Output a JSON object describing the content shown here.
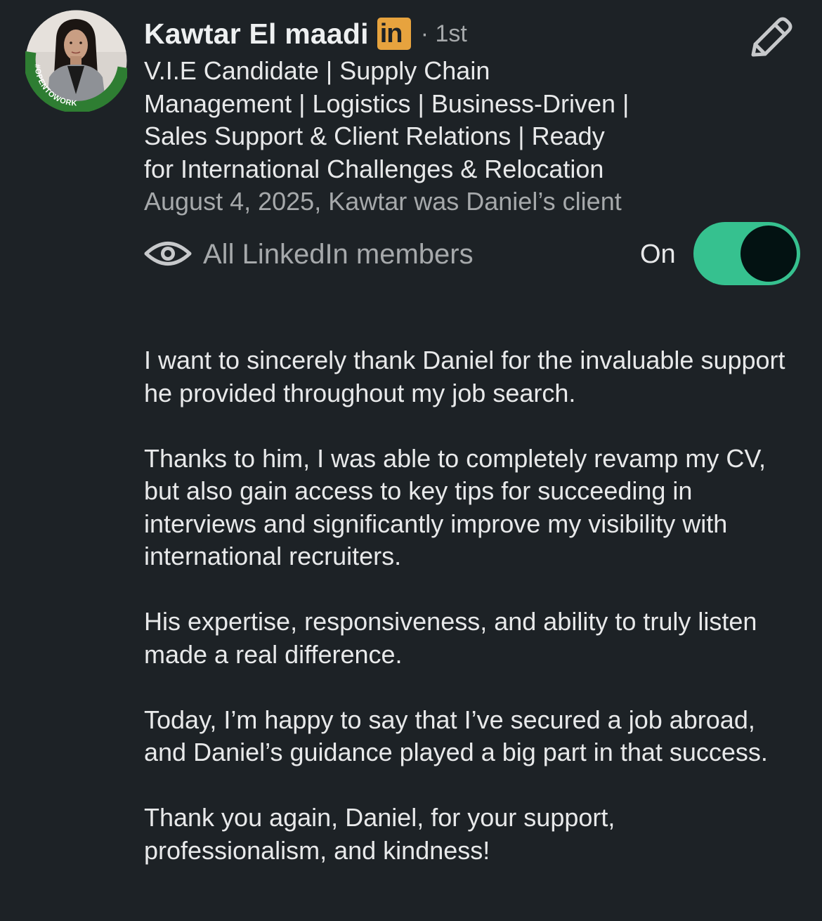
{
  "author": {
    "name": "Kawtar El maadi",
    "badge_text": "in",
    "degree": "· 1st",
    "avatar_frame_text": "#OPENTOWORK",
    "headline_lines": [
      "V.I.E Candidate | Supply Chain",
      "Management | Logistics | Business-Driven |",
      "Sales Support & Client Relations | Ready",
      "for International Challenges & Relocation"
    ],
    "meta": "August 4, 2025, Kawtar was Daniel’s client"
  },
  "visibility": {
    "icon": "eye-icon",
    "label": "All LinkedIn members",
    "toggle_state_label": "On",
    "toggle_on": true
  },
  "actions": {
    "edit_icon": "pencil-icon"
  },
  "recommendation": {
    "paragraphs": [
      "I want to sincerely thank Daniel for the invaluable support he provided throughout my job search.",
      "Thanks to him, I was able to completely revamp my CV, but also gain access to key tips for succeeding in interviews and significantly improve my visibility with international recruiters.",
      "His expertise, responsiveness, and ability to truly listen made a real difference.",
      "Today, I’m happy to say that I’ve secured a job abroad, and Daniel’s guidance played a big part in that success.",
      "Thank you again, Daniel, for your support, professionalism, and kindness!"
    ]
  },
  "colors": {
    "background": "#1d2226",
    "toggle_on": "#36c18f",
    "open_to_work_green": "#2e7d32",
    "premium_badge": "#e7a33e"
  }
}
